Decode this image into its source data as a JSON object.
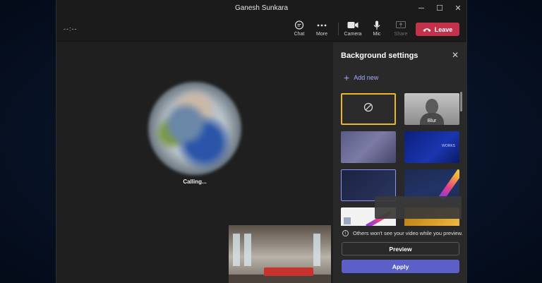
{
  "window": {
    "title": "Ganesh Sunkara",
    "controls": {
      "minimize": "─",
      "maximize": "☐",
      "close": "✕"
    }
  },
  "toolbar": {
    "timer": "--:--",
    "chat_label": "Chat",
    "more_label": "More",
    "camera_label": "Camera",
    "mic_label": "Mic",
    "share_label": "Share",
    "leave_label": "Leave",
    "leave_color": "#c4314b"
  },
  "stage": {
    "status": "Calling..."
  },
  "background_panel": {
    "title": "Background settings",
    "add_new_label": "Add new",
    "thumbnails": [
      {
        "name": "none",
        "label": "",
        "selected": true
      },
      {
        "name": "blur",
        "label": "Blur"
      },
      {
        "name": "purple-abstract",
        "label": ""
      },
      {
        "name": "blue-branded",
        "label": "",
        "overlay_text": "WORKS"
      },
      {
        "name": "navy-hovered",
        "label": ""
      },
      {
        "name": "rainbow-stripe",
        "label": ""
      },
      {
        "name": "yeah-team",
        "label": ""
      },
      {
        "name": "orange-room",
        "label": ""
      }
    ],
    "info_text": "Others won't see your video while you preview.",
    "preview_label": "Preview",
    "apply_label": "Apply",
    "accent_color": "#5b5fc7",
    "selection_color": "#e8b72e"
  }
}
